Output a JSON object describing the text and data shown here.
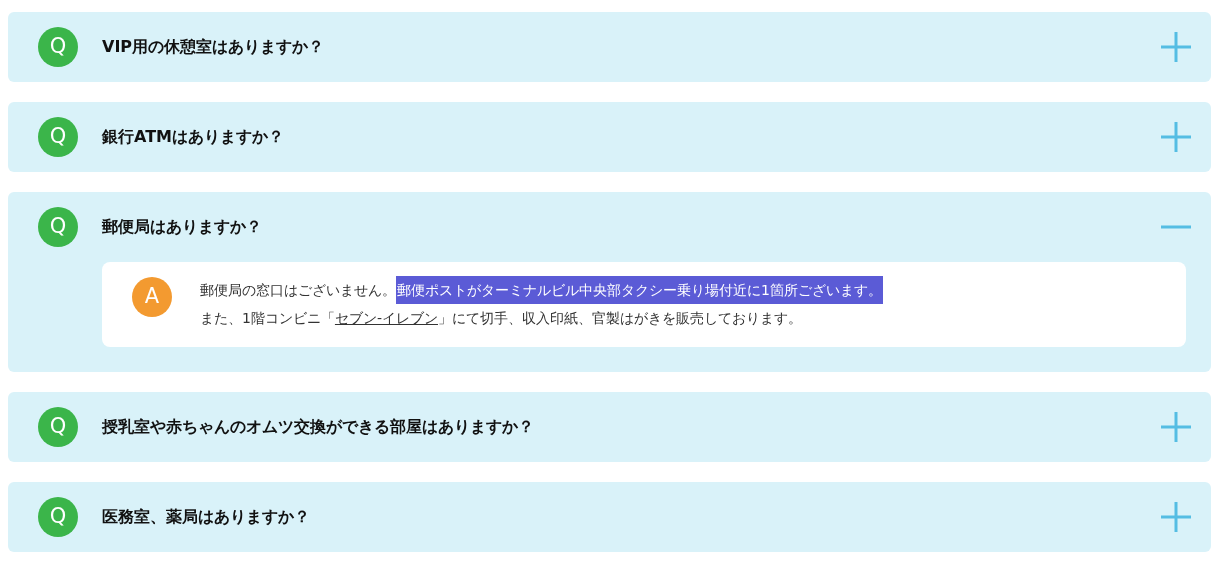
{
  "faq": [
    {
      "q_mark": "Q",
      "question": "VIP用の休憩室はありますか？",
      "expanded": false
    },
    {
      "q_mark": "Q",
      "question": "銀行ATMはありますか？",
      "expanded": false
    },
    {
      "q_mark": "Q",
      "question": "郵便局はありますか？",
      "expanded": true,
      "answer": {
        "a_mark": "A",
        "lines": [
          [
            {
              "kind": "text",
              "text": "郵便局の窓口はございません。"
            },
            {
              "kind": "selected",
              "text": "郵便ポストがターミナルビル中央部タクシー乗り場付近に1箇所ございます。"
            }
          ],
          [
            {
              "kind": "text",
              "text": "また、1階コンビニ「"
            },
            {
              "kind": "link",
              "text": "セブン‐イレブン"
            },
            {
              "kind": "text",
              "text": "」にて切手、収入印紙、官製はがきを販売しております。"
            }
          ]
        ]
      }
    },
    {
      "q_mark": "Q",
      "question": "授乳室や赤ちゃんのオムツ交換ができる部屋はありますか？",
      "expanded": false
    },
    {
      "q_mark": "Q",
      "question": "医務室、薬局はありますか？",
      "expanded": false
    }
  ]
}
